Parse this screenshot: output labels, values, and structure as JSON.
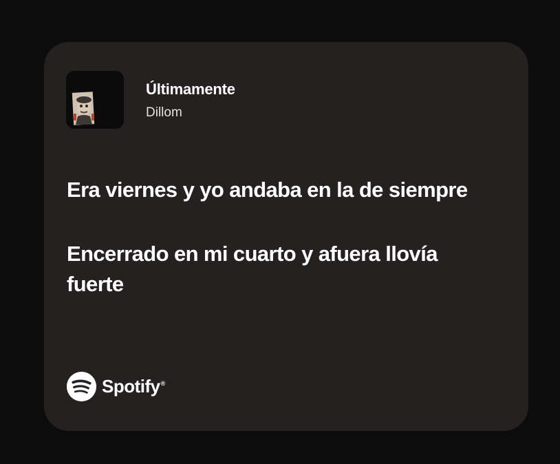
{
  "track": {
    "title": "Últimamente",
    "artist": "Dillom"
  },
  "lyrics": [
    "Era viernes y yo andaba en la de siempre",
    "Encerrado en mi cuarto y afuera llovía fuerte"
  ],
  "branding": {
    "name": "Spotify",
    "mark": "®",
    "icon": "spotify-logo-icon"
  },
  "colors": {
    "background": "#0d0c0d",
    "card": "#252121",
    "text": "#ffffff",
    "subtext": "#e4e1e1"
  }
}
